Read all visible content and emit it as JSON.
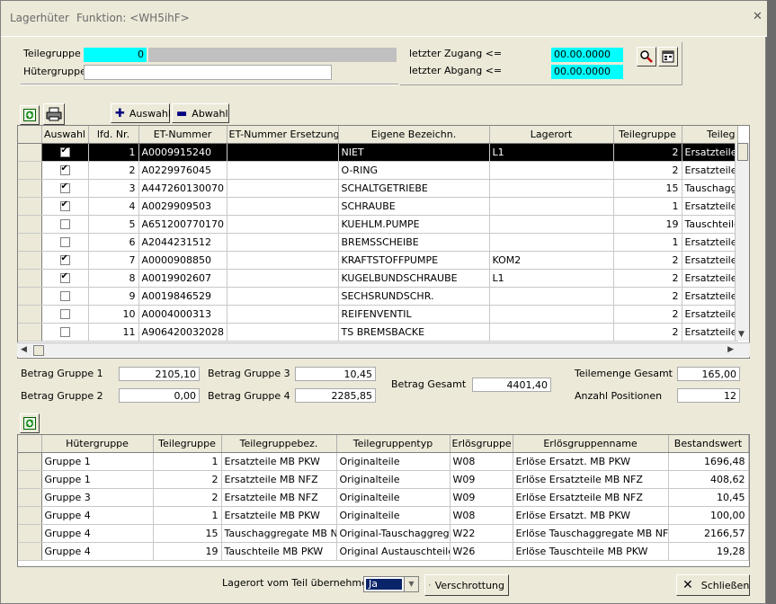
{
  "window": {
    "title": "Lagerhüter",
    "function": "Funktion: <WH5ihF>"
  },
  "filter": {
    "teilegruppe_label": "Teilegruppe",
    "teilegruppe_value": "0",
    "huetergruppe_label": "Hütergruppe",
    "huetergruppe_value": "",
    "letzter_zugang_label": "letzter Zugang <=",
    "letzter_zugang_value": "00.00.0000",
    "letzter_abgang_label": "letzter Abgang <=",
    "letzter_abgang_value": "00.00.0000"
  },
  "toolbar": {
    "auswahl_label": "Auswahl",
    "abwahl_label": "Abwahl"
  },
  "main_table": {
    "columns": [
      "Auswahl",
      "lfd. Nr.",
      "ET-Nummer",
      "ET-Nummer Ersetzung",
      "Eigene Bezeichn.",
      "Lagerort",
      "Teilegruppe",
      "Teileg"
    ],
    "rows": [
      {
        "checked": true,
        "nr": "1",
        "et": "A0009915240",
        "ers": "",
        "bez": "NIET",
        "ort": "L1",
        "tg": "2",
        "tgb": "Ersatzteile M",
        "selected": true
      },
      {
        "checked": true,
        "nr": "2",
        "et": "A0229976045",
        "ers": "",
        "bez": "O-RING",
        "ort": "",
        "tg": "2",
        "tgb": "Ersatzteile M"
      },
      {
        "checked": true,
        "nr": "3",
        "et": "A447260130070",
        "ers": "",
        "bez": "SCHALTGETRIEBE",
        "ort": "",
        "tg": "15",
        "tgb": "Tauschaggr"
      },
      {
        "checked": true,
        "nr": "4",
        "et": "A0029909503",
        "ers": "",
        "bez": "SCHRAUBE",
        "ort": "",
        "tg": "1",
        "tgb": "Ersatzteile M"
      },
      {
        "checked": false,
        "nr": "5",
        "et": "A651200770170",
        "ers": "",
        "bez": "KUEHLM.PUMPE",
        "ort": "",
        "tg": "19",
        "tgb": "Tauschteile"
      },
      {
        "checked": false,
        "nr": "6",
        "et": "A2044231512",
        "ers": "",
        "bez": "BREMSSCHEIBE",
        "ort": "",
        "tg": "1",
        "tgb": "Ersatzteile M"
      },
      {
        "checked": true,
        "nr": "7",
        "et": "A0000908850",
        "ers": "",
        "bez": "KRAFTSTOFFPUMPE",
        "ort": "KOM2",
        "tg": "2",
        "tgb": "Ersatzteile M"
      },
      {
        "checked": true,
        "nr": "8",
        "et": "A0019902607",
        "ers": "",
        "bez": "KUGELBUNDSCHRAUBE",
        "ort": "L1",
        "tg": "2",
        "tgb": "Ersatzteile M"
      },
      {
        "checked": false,
        "nr": "9",
        "et": "A0019846529",
        "ers": "",
        "bez": "SECHSRUNDSCHR.",
        "ort": "",
        "tg": "2",
        "tgb": "Ersatzteile M"
      },
      {
        "checked": false,
        "nr": "10",
        "et": "A0004000313",
        "ers": "",
        "bez": "REIFENVENTIL",
        "ort": "",
        "tg": "2",
        "tgb": "Ersatzteile M"
      },
      {
        "checked": false,
        "nr": "11",
        "et": "A906420032028",
        "ers": "",
        "bez": "TS BREMSBACKE",
        "ort": "",
        "tg": "2",
        "tgb": "Ersatzteile M"
      }
    ]
  },
  "totals": {
    "g1_label": "Betrag Gruppe 1",
    "g1_value": "2105,10",
    "g2_label": "Betrag Gruppe 2",
    "g2_value": "0,00",
    "g3_label": "Betrag Gruppe 3",
    "g3_value": "10,45",
    "g4_label": "Betrag Gruppe 4",
    "g4_value": "2285,85",
    "gesamt_label": "Betrag Gesamt",
    "gesamt_value": "4401,40",
    "menge_label": "Teilemenge Gesamt",
    "menge_value": "165,00",
    "anzahl_label": "Anzahl Positionen",
    "anzahl_value": "12"
  },
  "summary_table": {
    "columns": [
      "Hütergruppe",
      "Teilegruppe",
      "Teilegruppebez.",
      "Teilegruppentyp",
      "Erlösgruppe",
      "Erlösgruppenname",
      "Bestandswert"
    ],
    "rows": [
      {
        "hg": "Gruppe 1",
        "tg": "1",
        "bez": "Ersatzteile MB PKW",
        "typ": "Originalteile",
        "eg": "W08",
        "egn": "Erlöse Ersatzt. MB PKW",
        "wert": "1696,48"
      },
      {
        "hg": "Gruppe 1",
        "tg": "2",
        "bez": "Ersatzteile MB NFZ",
        "typ": "Originalteile",
        "eg": "W09",
        "egn": "Erlöse Ersatzteile MB NFZ",
        "wert": "408,62"
      },
      {
        "hg": "Gruppe 3",
        "tg": "2",
        "bez": "Ersatzteile MB NFZ",
        "typ": "Originalteile",
        "eg": "W09",
        "egn": "Erlöse Ersatzteile MB NFZ",
        "wert": "10,45"
      },
      {
        "hg": "Gruppe 4",
        "tg": "1",
        "bez": "Ersatzteile MB PKW",
        "typ": "Originalteile",
        "eg": "W08",
        "egn": "Erlöse Ersatzt. MB PKW",
        "wert": "100,00"
      },
      {
        "hg": "Gruppe 4",
        "tg": "15",
        "bez": "Tauschaggregate MB N",
        "typ": "Original-Tauschaggregate",
        "eg": "W22",
        "egn": "Erlöse Tauschaggregate MB NFZ",
        "wert": "2166,57"
      },
      {
        "hg": "Gruppe 4",
        "tg": "19",
        "bez": "Tauschteile MB PKW",
        "typ": "Original Austauschteile",
        "eg": "W26",
        "egn": "Erlöse Tauschteile MB PKW",
        "wert": "19,28"
      }
    ]
  },
  "footer": {
    "lagerort_label": "Lagerort vom Teil übernehmen",
    "lagerort_value": "Ja",
    "verschrottung_label": "Verschrottung",
    "schliessen_label": "Schließen"
  }
}
